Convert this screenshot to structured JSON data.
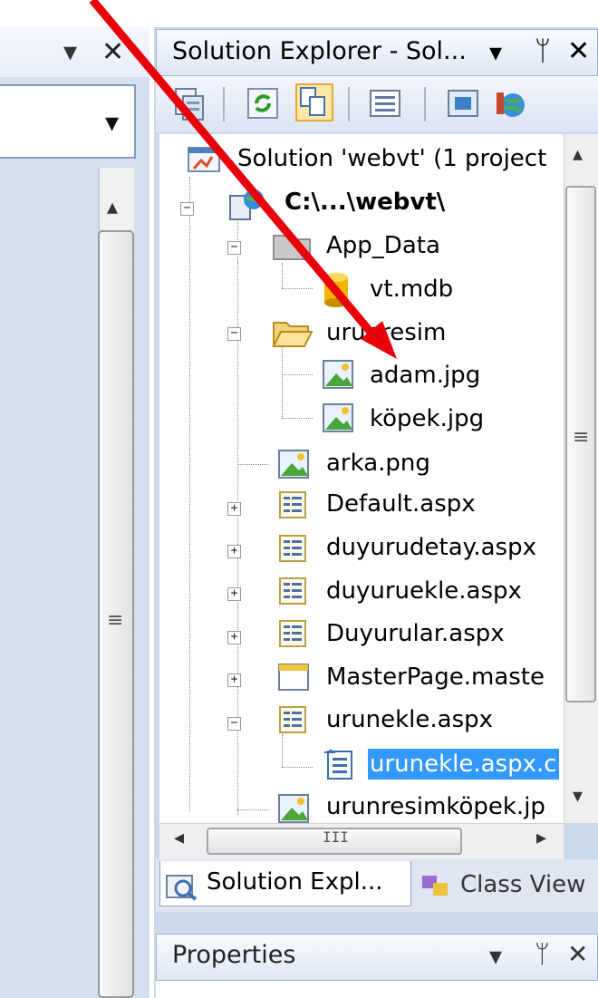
{
  "left_pane": {
    "dropdown_glyph": "▾",
    "close_glyph": "✕",
    "combo_glyph": "▾"
  },
  "solution_explorer": {
    "title": "Solution Explorer - Sol...",
    "title_menu_glyph": "▾",
    "title_pin_glyph": "ᛘ",
    "title_close_glyph": "✕",
    "toolbar_icons": [
      "properties-icon",
      "refresh-icon",
      "show-all-files-icon",
      "view-code-icon",
      "view-designer-icon",
      "copy-website-icon"
    ],
    "tree": {
      "solution": "Solution 'webvt' (1 project",
      "project": "C:\\...\\webvt\\",
      "app_data": "App_Data",
      "vt_mdb": "vt.mdb",
      "urunresim": "urunresim",
      "adam": "adam.jpg",
      "kopek": "köpek.jpg",
      "arka": "arka.png",
      "default": "Default.aspx",
      "duyurudetay": "duyurudetay.aspx",
      "duyuruekle": "duyuruekle.aspx",
      "duyurular": "Duyurular.aspx",
      "masterpage": "MasterPage.maste",
      "urunekle": "urunekle.aspx",
      "urunekle_cs": "urunekle.aspx.c",
      "urunresimkopek": "urunresimköpek.jp"
    },
    "scroll": {
      "up": "▴",
      "down": "▾",
      "grip": "≡",
      "left": "◂",
      "right": "▸",
      "hgrip": "III"
    }
  },
  "tabs": {
    "solution_explorer": "Solution Expl...",
    "class_view": "Class View"
  },
  "properties": {
    "title": "Properties",
    "menu_glyph": "▾",
    "pin_glyph": "ᛘ",
    "close_glyph": "✕"
  },
  "colors": {
    "selection": "#3399ff",
    "annotation_arrow": "#e8000b",
    "panel_frame": "#ccd9ea"
  }
}
